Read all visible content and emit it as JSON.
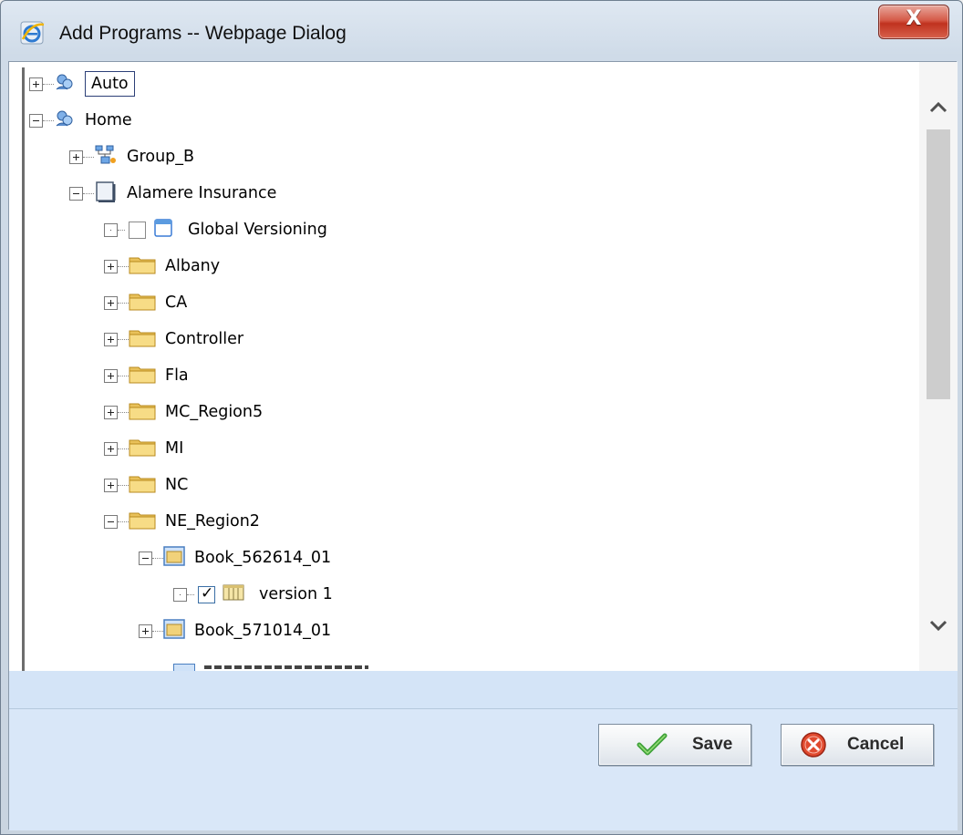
{
  "window": {
    "title": "Add Programs -- Webpage Dialog",
    "close_label": "X"
  },
  "tree": [
    {
      "label": "Auto",
      "expander": "plus",
      "icon": "group-icon",
      "selected": true
    },
    {
      "label": "Home",
      "expander": "minus",
      "icon": "group-icon"
    },
    {
      "label": "Group_B",
      "expander": "plus",
      "icon": "network-group-icon"
    },
    {
      "label": "Alamere Insurance",
      "expander": "minus",
      "icon": "company-icon"
    },
    {
      "label": "Global Versioning",
      "expander": "leaf",
      "icon": "window-icon",
      "checkbox": false
    },
    {
      "label": "Albany",
      "expander": "plus",
      "icon": "folder-icon"
    },
    {
      "label": "CA",
      "expander": "plus",
      "icon": "folder-icon"
    },
    {
      "label": "Controller",
      "expander": "plus",
      "icon": "folder-icon"
    },
    {
      "label": "Fla",
      "expander": "plus",
      "icon": "folder-icon"
    },
    {
      "label": "MC_Region5",
      "expander": "plus",
      "icon": "folder-icon"
    },
    {
      "label": "MI",
      "expander": "plus",
      "icon": "folder-icon"
    },
    {
      "label": "NC",
      "expander": "plus",
      "icon": "folder-icon"
    },
    {
      "label": "NE_Region2",
      "expander": "minus",
      "icon": "folder-icon"
    },
    {
      "label": "Book_562614_01",
      "expander": "minus",
      "icon": "book-icon"
    },
    {
      "label": "version 1",
      "expander": "leaf",
      "icon": "table-icon",
      "checkbox": true
    },
    {
      "label": "Book_571014_01",
      "expander": "plus",
      "icon": "book-icon"
    }
  ],
  "buttons": {
    "save_label": "Save",
    "cancel_label": "Cancel"
  },
  "colors": {
    "footer_bg": "#d9e7f8",
    "strip_bg": "#d4e4f7",
    "close_red": "#c0321f",
    "selection_border": "#2c3f77"
  }
}
